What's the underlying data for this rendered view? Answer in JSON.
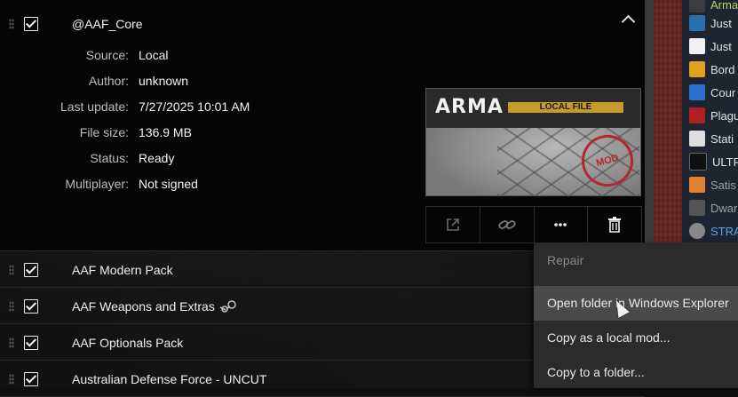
{
  "expanded_mod": {
    "title": "@AAF_Core",
    "details": [
      {
        "label": "Source:",
        "value": "Local"
      },
      {
        "label": "Author:",
        "value": "unknown"
      },
      {
        "label": "Last update:",
        "value": "7/27/2025 10:01 AM"
      },
      {
        "label": "File size:",
        "value": "136.9 MB"
      },
      {
        "label": "Status:",
        "value": "Ready"
      },
      {
        "label": "Multiplayer:",
        "value": "Not signed"
      }
    ],
    "thumbnail": {
      "logo_text": "ARMA",
      "banner_text": "LOCAL FILE",
      "stamp_text": "MOD"
    },
    "actions": [
      "open-external-icon",
      "link-icon",
      "more-icon",
      "trash-icon"
    ]
  },
  "mod_rows": [
    {
      "title": "AAF Modern Pack",
      "steam": false
    },
    {
      "title": "AAF Weapons and Extras",
      "steam": true
    },
    {
      "title": "AAF Optionals Pack",
      "steam": false
    },
    {
      "title": "Australian Defense Force - UNCUT",
      "steam": false
    }
  ],
  "context_menu": {
    "items": [
      {
        "label": "Repair",
        "state": "disabled"
      },
      {
        "label": "Open folder in Windows Explorer",
        "state": "hover"
      },
      {
        "label": "Copy as a local mod...",
        "state": "normal"
      },
      {
        "label": "Copy to a folder...",
        "state": "normal"
      }
    ]
  },
  "game_list": {
    "items": [
      {
        "label": "Arma",
        "color": "#3c3c3c"
      },
      {
        "label": "Just",
        "color": "#2a6fb0"
      },
      {
        "label": "Just",
        "color": "#f0f0f0"
      },
      {
        "label": "Bord",
        "color": "#e0a020"
      },
      {
        "label": "Cour",
        "color": "#2a6fd0"
      },
      {
        "label": "Plagu",
        "color": "#b02020"
      },
      {
        "label": "Stati",
        "color": "#dddddd"
      },
      {
        "label": "ULTR",
        "color": "#111111"
      },
      {
        "label": "Satis",
        "color": "#e08030"
      },
      {
        "label": "Dwar",
        "color": "#555555"
      },
      {
        "label": "STRA",
        "color": "#888888"
      }
    ]
  },
  "colors": {
    "accent_link": "#5aa8e8",
    "highlight_green": "#b6d85a"
  }
}
